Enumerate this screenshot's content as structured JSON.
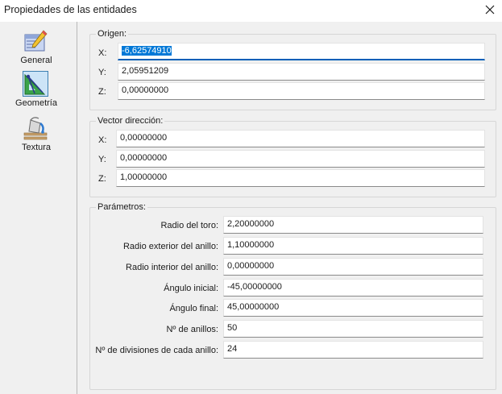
{
  "window": {
    "title": "Propiedades de las entidades"
  },
  "sidebar": {
    "items": [
      {
        "label": "General",
        "icon": "pencil-ruler-icon"
      },
      {
        "label": "Geometría",
        "icon": "geometry-compass-icon"
      },
      {
        "label": "Textura",
        "icon": "paint-bucket-icon"
      }
    ],
    "active_index": 1
  },
  "origin": {
    "legend": "Origen:",
    "rows": [
      {
        "label": "X:",
        "value": "-6,62574910"
      },
      {
        "label": "Y:",
        "value": "2,05951209"
      },
      {
        "label": "Z:",
        "value": "0,00000000"
      }
    ]
  },
  "direction": {
    "legend": "Vector dirección:",
    "rows": [
      {
        "label": "X:",
        "value": "0,00000000"
      },
      {
        "label": "Y:",
        "value": "0,00000000"
      },
      {
        "label": "Z:",
        "value": "1,00000000"
      }
    ]
  },
  "params": {
    "legend": "Parámetros:",
    "rows": [
      {
        "label": "Radio del toro:",
        "value": "2,20000000"
      },
      {
        "label": "Radio exterior del anillo:",
        "value": "1,10000000"
      },
      {
        "label": "Radio interior del anillo:",
        "value": "0,00000000"
      },
      {
        "label": "Ángulo inicial:",
        "value": "-45,00000000"
      },
      {
        "label": "Ángulo final:",
        "value": "45,00000000"
      },
      {
        "label": "Nº de anillos:",
        "value": "50"
      },
      {
        "label": "Nº de divisiones de cada anillo:",
        "value": "24"
      }
    ]
  },
  "colors": {
    "accent": "#005fb8",
    "selection": "#0078d7",
    "panel": "#f0f0f0"
  }
}
